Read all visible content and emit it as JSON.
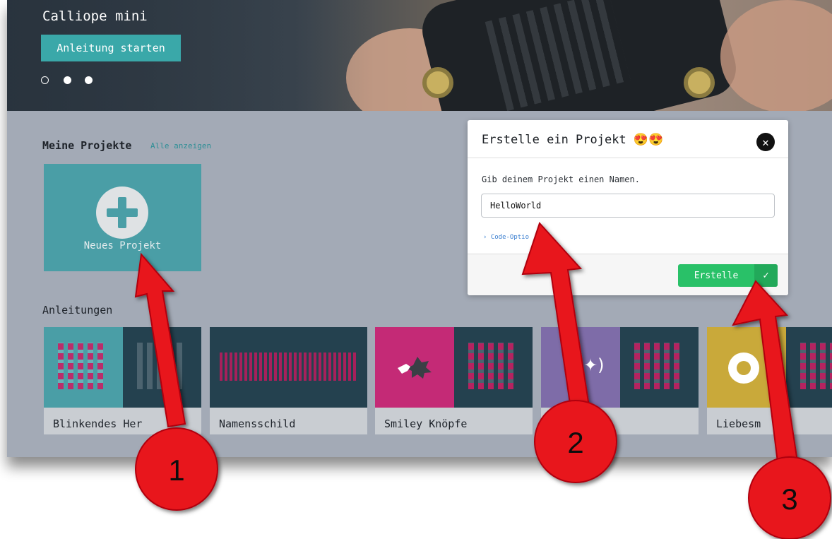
{
  "hero": {
    "title": "Calliope mini",
    "start_button": "Anleitung starten",
    "carousel_dots": [
      "empty",
      "full",
      "full"
    ]
  },
  "my_projects": {
    "title": "Meine Projekte",
    "show_all": "Alle anzeigen",
    "new_project": "Neues Projekt",
    "icon": "plus-icon"
  },
  "tutorials": {
    "title": "Anleitungen",
    "cards": [
      {
        "label": "Blinkendes Her"
      },
      {
        "label": "Namensschild"
      },
      {
        "label": "Smiley Knöpfe"
      },
      {
        "label": ""
      },
      {
        "label": "Liebesm"
      }
    ]
  },
  "dialog": {
    "title": "Erstelle ein Projekt 😍😍",
    "close_icon": "close-icon",
    "prompt": "Gib deinem Projekt einen Namen.",
    "input_value": "HelloWorld",
    "code_options": "› Code-Optio",
    "create_button": "Erstelle",
    "check_icon": "✓"
  },
  "annotations": {
    "colors": {
      "arrow": "#e8141c",
      "circle": "#e8141c"
    },
    "markers": [
      "1",
      "2",
      "3"
    ]
  }
}
